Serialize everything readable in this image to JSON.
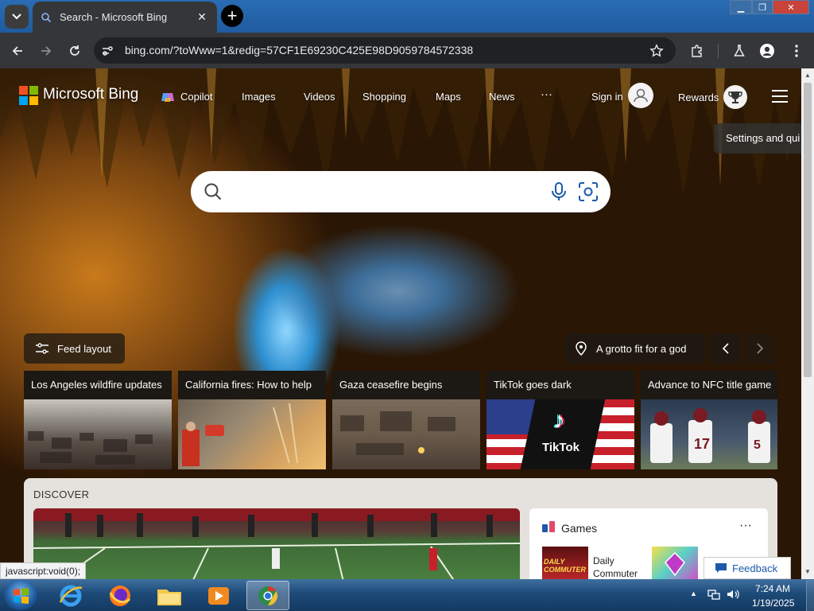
{
  "browser": {
    "tab_title": "Search - Microsoft Bing",
    "url": "bing.com/?toWww=1&redig=57CF1E69230C425E98D9059784572338"
  },
  "header": {
    "brand": "Microsoft Bing",
    "nav": [
      "Copilot",
      "Images",
      "Videos",
      "Shopping",
      "Maps",
      "News"
    ],
    "more": "···",
    "sign_in": "Sign in",
    "rewards": "Rewards",
    "settings_tooltip": "Settings and qui"
  },
  "controls": {
    "feed_layout": "Feed layout",
    "image_caption": "A grotto fit for a god"
  },
  "news": [
    {
      "title": "Los Angeles wildfire updates"
    },
    {
      "title": "California fires: How to help"
    },
    {
      "title": "Gaza ceasefire begins"
    },
    {
      "title": "TikTok goes dark"
    },
    {
      "title": "Advance to NFC title game"
    }
  ],
  "discover": {
    "heading": "DISCOVER",
    "games_title": "Games",
    "games_more": "···",
    "game1_line1": "Daily",
    "game1_line2": "Commuter",
    "game1_logo_text": "DAILY COMMUTER",
    "tiktok_text": "TikTok"
  },
  "feedback": "Feedback",
  "status_text": "javascript:void(0);",
  "taskbar": {
    "time": "7:24 AM",
    "date": "1/19/2025"
  },
  "colors": {
    "bing_blue": "#1a5aa8",
    "taskbar": "#1d4a78"
  }
}
